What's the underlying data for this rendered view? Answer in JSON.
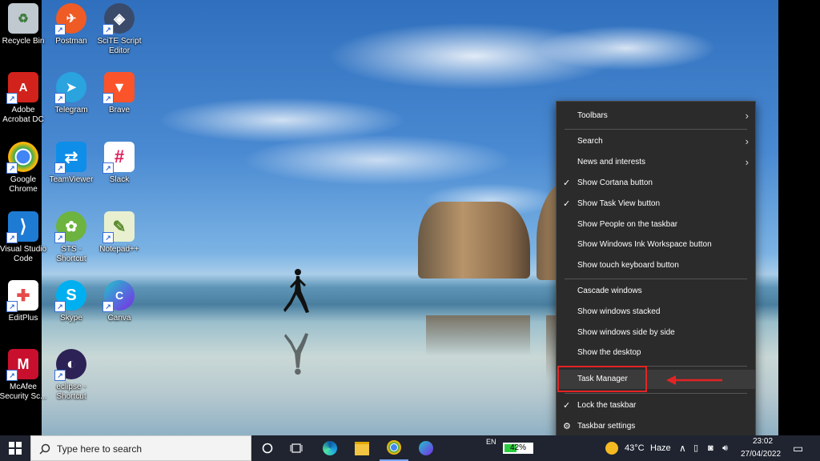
{
  "desktop": {
    "icons": [
      {
        "label": "Recycle Bin",
        "icon": "recycle-bin-icon",
        "color": "#c0c8d0",
        "glyph": "♻"
      },
      {
        "label": "Adobe Acrobat DC",
        "icon": "adobe-acrobat-icon",
        "color": "#d1221c",
        "glyph": "A"
      },
      {
        "label": "Google Chrome",
        "icon": "chrome-icon",
        "color": "#ffffff",
        "glyph": "●"
      },
      {
        "label": "Visual Studio Code",
        "icon": "vscode-icon",
        "color": "#1e7bd4",
        "glyph": "⟩"
      },
      {
        "label": "EditPlus",
        "icon": "editplus-icon",
        "color": "#e64a4a",
        "glyph": "✚"
      },
      {
        "label": "McAfee Security Sc...",
        "icon": "mcafee-icon",
        "color": "#c8102e",
        "glyph": "M"
      },
      {
        "label": "Postman",
        "icon": "postman-icon",
        "color": "#ef5b25",
        "glyph": "✈"
      },
      {
        "label": "Telegram",
        "icon": "telegram-icon",
        "color": "#2aa3df",
        "glyph": "➤"
      },
      {
        "label": "TeamViewer",
        "icon": "teamviewer-icon",
        "color": "#0e8ee9",
        "glyph": "⇄"
      },
      {
        "label": "STS - Shortcut",
        "icon": "sts-icon",
        "color": "#6db33f",
        "glyph": "✿"
      },
      {
        "label": "Skype",
        "icon": "skype-icon",
        "color": "#00aff0",
        "glyph": "S"
      },
      {
        "label": "eclipse - Shortcut",
        "icon": "eclipse-icon",
        "color": "#2c2255",
        "glyph": "◐"
      },
      {
        "label": "SciTE Script Editor",
        "icon": "scite-icon",
        "color": "#3a4a6a",
        "glyph": "◈"
      },
      {
        "label": "Brave",
        "icon": "brave-icon",
        "color": "#fb542b",
        "glyph": "▼"
      },
      {
        "label": "Slack",
        "icon": "slack-icon",
        "color": "#ffffff",
        "glyph": "#"
      },
      {
        "label": "Notepad++",
        "icon": "notepadpp-icon",
        "color": "#8bc34a",
        "glyph": "✎"
      },
      {
        "label": "Canva",
        "icon": "canva-icon",
        "color": "#20c4cb",
        "glyph": "C"
      }
    ]
  },
  "context_menu": {
    "items": [
      {
        "label": "Toolbars",
        "checked": false,
        "submenu": true
      },
      {
        "label": "Search",
        "checked": false,
        "submenu": true
      },
      {
        "label": "News and interests",
        "checked": false,
        "submenu": true
      },
      {
        "label": "Show Cortana button",
        "checked": true,
        "submenu": false
      },
      {
        "label": "Show Task View button",
        "checked": true,
        "submenu": false
      },
      {
        "label": "Show People on the taskbar",
        "checked": false,
        "submenu": false
      },
      {
        "label": "Show Windows Ink Workspace button",
        "checked": false,
        "submenu": false
      },
      {
        "label": "Show touch keyboard button",
        "checked": false,
        "submenu": false
      },
      {
        "label": "Cascade windows",
        "checked": false,
        "submenu": false
      },
      {
        "label": "Show windows stacked",
        "checked": false,
        "submenu": false
      },
      {
        "label": "Show windows side by side",
        "checked": false,
        "submenu": false
      },
      {
        "label": "Show the desktop",
        "checked": false,
        "submenu": false
      },
      {
        "label": "Task Manager",
        "checked": false,
        "submenu": false
      },
      {
        "label": "Lock the taskbar",
        "checked": true,
        "submenu": false
      },
      {
        "label": "Taskbar settings",
        "checked": false,
        "submenu": false
      }
    ],
    "highlight_color": "#e32424"
  },
  "taskbar": {
    "search_placeholder": "Type here to search",
    "language": "EN",
    "battery": "42%",
    "weather_temp": "43°C",
    "weather_desc": "Haze",
    "time": "23:02",
    "date": "27/04/2022"
  }
}
